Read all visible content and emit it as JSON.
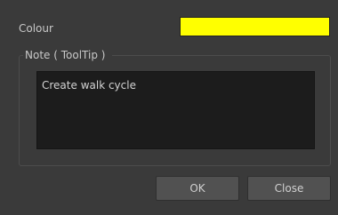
{
  "dialog": {
    "colour_label": "Colour",
    "colour_value": "#FFFF00",
    "note_group_title": "Note ( ToolTip )",
    "note_text": "Create walk cycle"
  },
  "buttons": {
    "ok_label": "OK",
    "close_label": "Close"
  }
}
